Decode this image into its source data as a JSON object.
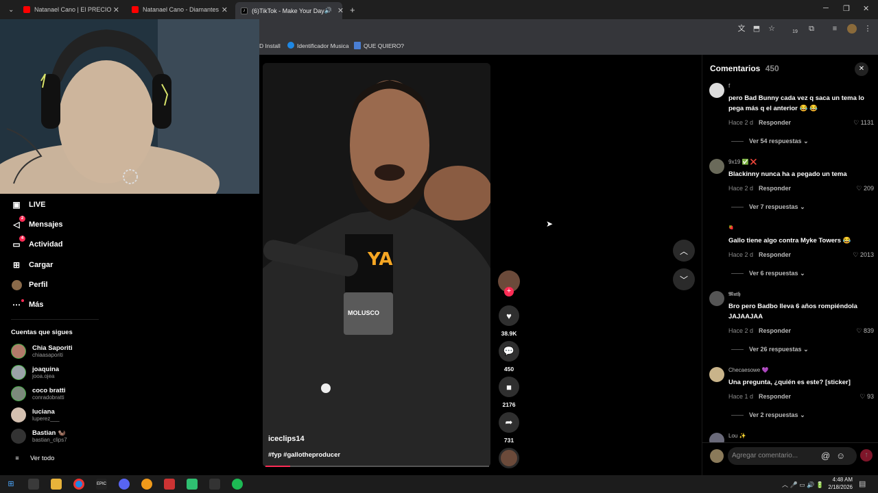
{
  "browser": {
    "tabs": [
      {
        "title": "Natanael Cano | El PRECIO a PA",
        "active": false
      },
      {
        "title": "Natanael Cano - Diamantes [Of",
        "active": false
      },
      {
        "title": "(6)TikTok - Make Your Day",
        "active": true
      }
    ],
    "new_tab": "+",
    "bookmarks": [
      "D Install",
      "Identificador Musica",
      "QUE QUIERO?"
    ],
    "extension_count": "19"
  },
  "nav": {
    "items": [
      {
        "label": "LIVE",
        "icon": "live-icon",
        "badge": ""
      },
      {
        "label": "Mensajes",
        "icon": "messages-icon",
        "badge": "2"
      },
      {
        "label": "Actividad",
        "icon": "activity-icon",
        "badge": "4"
      },
      {
        "label": "Cargar",
        "icon": "upload-icon",
        "badge": ""
      },
      {
        "label": "Perfil",
        "icon": "profile-icon",
        "badge": ""
      },
      {
        "label": "Más",
        "icon": "more-icon",
        "badge": ""
      }
    ],
    "following_title": "Cuentas que sigues",
    "following": [
      {
        "name": "Chia Saporiti",
        "user": "chiaasaporiti"
      },
      {
        "name": "joaquina",
        "user": "jooa.ojea"
      },
      {
        "name": "coco bratti",
        "user": "conradobratti"
      },
      {
        "name": "luciana",
        "user": "luperez___"
      },
      {
        "name": "Bastian 🦦",
        "user": "bastian_clips7"
      }
    ],
    "see_all": "Ver todo"
  },
  "video": {
    "author": "iceclips14",
    "caption": "#fyp #gallotheproducer",
    "overlay_text": "YA",
    "mic_brand": "MOLUSCO",
    "progress": 0.11
  },
  "actions": {
    "likes": "38.9K",
    "comments": "450",
    "saves": "2176",
    "shares": "731"
  },
  "comments": {
    "title": "Comentarios",
    "count": "450",
    "reply_label": "Responder",
    "items": [
      {
        "user": "f",
        "text": "pero Bad Bunny cada vez q saca un tema lo pega más q el anterior 😂 😂",
        "time": "Hace 2 d",
        "likes": "1131",
        "replies": "Ver 54 respuestas"
      },
      {
        "user": "9x19 ✅ ❌",
        "text": "Blackinny nunca ha a pegado un tema",
        "time": "Hace 2 d",
        "likes": "209",
        "replies": "Ver 7 respuestas"
      },
      {
        "user": "🍓",
        "text": "Gallo tiene algo contra Myke Towers 😂",
        "time": "Hace 2 d",
        "likes": "2013",
        "replies": "Ver 6 respuestas"
      },
      {
        "user": "𝕸𝖆𝖙𝖍",
        "text": "Bro pero Badbo lleva 6 años rompiéndola JAJAAJAA",
        "time": "Hace 2 d",
        "likes": "839",
        "replies": "Ver 26 respuestas"
      },
      {
        "user": "Checaesowe 💜",
        "text": "Una pregunta, ¿quién es este? [sticker]",
        "time": "Hace 1 d",
        "likes": "93",
        "replies": "Ver 2 respuestas"
      },
      {
        "user": "Lou ✨",
        "text": "",
        "time": "",
        "likes": "",
        "replies": ""
      }
    ],
    "input_placeholder": "Agregar comentario..."
  },
  "taskbar": {
    "time": "4:48 AM",
    "date": "2/18/2026"
  },
  "colors": {
    "accent": "#fe2c55",
    "background": "#000000",
    "chrome": "#35363a"
  }
}
